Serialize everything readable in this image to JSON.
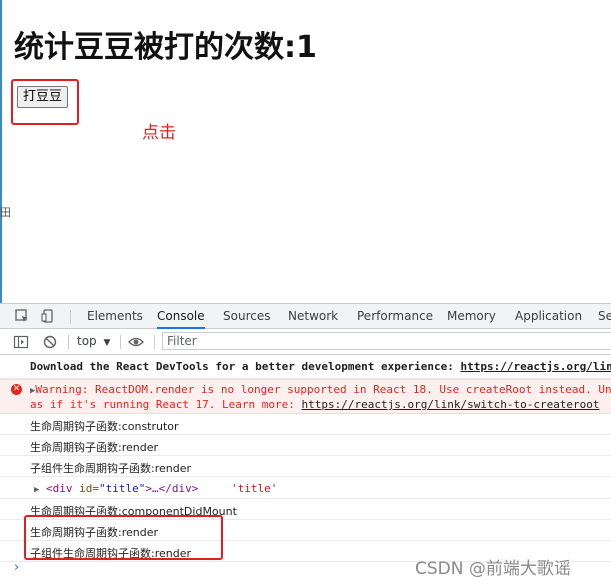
{
  "page": {
    "heading": "统计豆豆被打的次数:1",
    "button_label": "打豆豆",
    "click_hint": "点击"
  },
  "devtools": {
    "tabs": [
      {
        "label": "Elements"
      },
      {
        "label": "Console",
        "active": true
      },
      {
        "label": "Sources"
      },
      {
        "label": "Network"
      },
      {
        "label": "Performance"
      },
      {
        "label": "Memory"
      },
      {
        "label": "Application"
      },
      {
        "label": "Se"
      }
    ],
    "toolbar": {
      "context": "top",
      "filter_placeholder": "Filter"
    },
    "console": {
      "info_text": "Download the React DevTools for a better development experience: ",
      "info_link": "https://reactjs.org/lin",
      "warning_line1": "Warning: ReactDOM.render is no longer supported in React 18. Use createRoot instead. Un",
      "warning_line2_prefix": "as if it's running React 17. Learn more: ",
      "warning_link": "https://reactjs.org/link/switch-to-createroot",
      "log_constructor": "生命周期钩子函数:construtor",
      "log_render1": "生命周期钩子函数:render",
      "log_child_render1": "子组件生命周期钩子函数:render",
      "div_open": "<div",
      "div_attr": " id=",
      "div_val": "\"title\"",
      "div_rest": ">…</div>",
      "div_string": "'title'",
      "log_did_mount": "生命周期钩子函数:componentDidMount",
      "log_render2": "生命周期钩子函数:render",
      "log_child_render2": "子组件生命周期钩子函数:render",
      "prompt": "›"
    }
  },
  "watermark": "CSDN @前端大歌谣",
  "colors": {
    "annotation_red": "#e02020",
    "console_active_tab": "#1a73e8"
  }
}
